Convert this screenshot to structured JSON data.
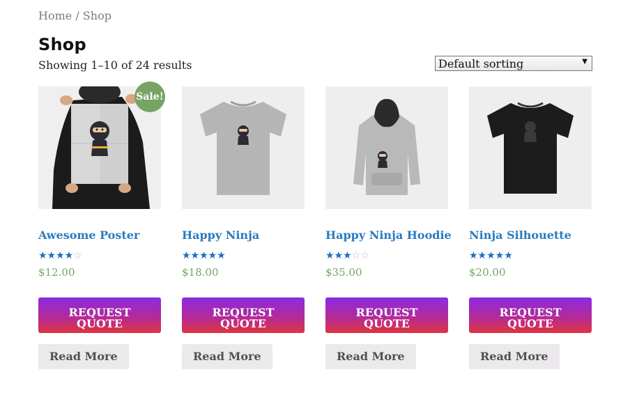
{
  "breadcrumb": {
    "home": "Home",
    "sep": " / ",
    "current": "Shop"
  },
  "page": {
    "title": "Shop",
    "result_count": "Showing 1–10 of 24 results",
    "sorting": {
      "selected": "Default sorting"
    }
  },
  "colors": {
    "link": "#2a7bbf",
    "price": "#77a464",
    "sale": "#77a464",
    "star": "#1a6ec0",
    "quote_gradient": [
      "#8a2be2",
      "#e0343e"
    ],
    "read_more_bg": "#ebe9eb"
  },
  "products": [
    {
      "name": "Awesome Poster",
      "rating": 4,
      "rating_max": 5,
      "price": "$12.00",
      "sale_badge": "Sale!",
      "quote_label": "REQUEST\nQUOTE",
      "read_more_label": "Read More",
      "image_icon": "poster-ninja"
    },
    {
      "name": "Happy Ninja",
      "rating": 5,
      "rating_max": 5,
      "price": "$18.00",
      "quote_label": "REQUEST\nQUOTE",
      "read_more_label": "Read More",
      "image_icon": "grey-tshirt-ninja"
    },
    {
      "name": "Happy Ninja Hoodie",
      "rating": 3,
      "rating_max": 5,
      "price": "$35.00",
      "quote_label": "REQUEST\nQUOTE",
      "read_more_label": "Read More",
      "image_icon": "grey-hoodie-ninja"
    },
    {
      "name": "Ninja Silhouette",
      "rating": 5,
      "rating_max": 5,
      "price": "$20.00",
      "quote_label": "REQUEST\nQUOTE",
      "read_more_label": "Read More",
      "image_icon": "black-tshirt-silhouette"
    }
  ]
}
